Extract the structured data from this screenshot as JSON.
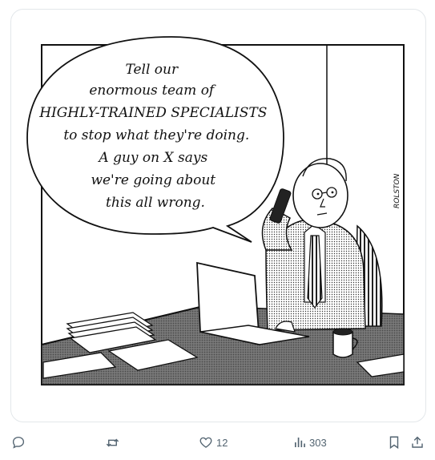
{
  "cartoon": {
    "speech_lines": [
      "Tell our",
      "enormous team of",
      "HIGHLY-TRAINED SPECIALISTS",
      "to stop what they're doing.",
      "A guy on X says",
      "we're going about",
      "this all wrong."
    ],
    "signature": "ROLSTON"
  },
  "actions": {
    "reply": {
      "icon": "reply-icon"
    },
    "repost": {
      "icon": "repost-icon"
    },
    "like": {
      "icon": "heart-icon",
      "count": "12"
    },
    "views": {
      "icon": "views-icon",
      "count": "303"
    },
    "bookmark": {
      "icon": "bookmark-icon"
    },
    "share": {
      "icon": "share-icon"
    }
  },
  "colors": {
    "icon_gray": "#536471",
    "card_border": "#e3e7ea",
    "ink": "#111111",
    "desk_gray": "#6b6b6b"
  }
}
